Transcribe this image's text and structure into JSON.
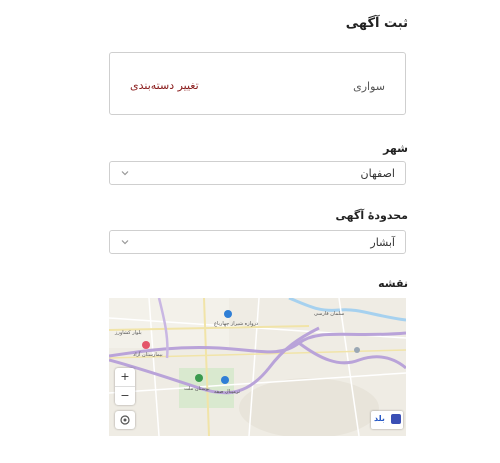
{
  "page_title": "ثبت آگهی",
  "category": {
    "name": "سواری",
    "change_label": "تغییر دسته‌بندی"
  },
  "city": {
    "label": "شهر",
    "value": "اصفهان"
  },
  "region": {
    "label": "محدودهٔ آگهی",
    "value": "آبشار"
  },
  "map": {
    "label": "نقشه",
    "zoom_in": "+",
    "zoom_out": "−",
    "brand": "بلد",
    "place_labels": {
      "salman": "سلمان فارسی",
      "keshavarz": "بلوار کشاورز",
      "gate": "دروازه شیراز چهارباغ",
      "hospital": "بیمارستان آزاد",
      "park": "بوستان ملت",
      "terminal": "ترمینال صفه"
    }
  },
  "colors": {
    "change_link": "#8a1c1c",
    "map_road_major": "#b9a3d9",
    "map_water": "#a6d1ef",
    "map_poi": "#2f7fd6"
  }
}
